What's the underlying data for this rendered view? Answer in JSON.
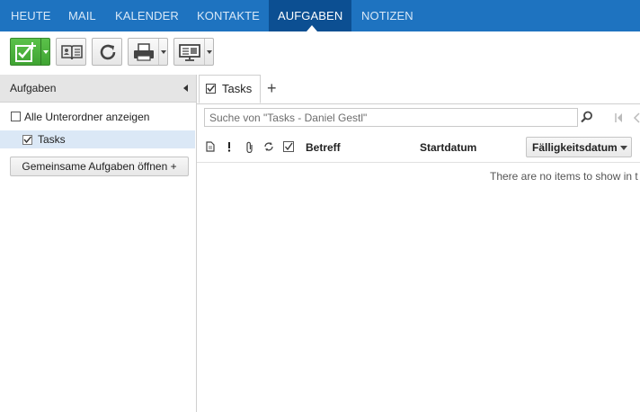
{
  "nav": {
    "items": [
      "HEUTE",
      "MAIL",
      "KALENDER",
      "KONTAKTE",
      "AUFGABEN",
      "NOTIZEN"
    ],
    "active_index": 4
  },
  "toolbar": {
    "buttons": [
      "new-task",
      "address-book",
      "refresh",
      "print",
      "view"
    ]
  },
  "sidebar": {
    "title": "Aufgaben",
    "show_subfolders_label": "Alle Unterordner anzeigen",
    "folders": [
      {
        "label": "Tasks",
        "checked": true
      }
    ],
    "shared_button_label": "Gemeinsame Aufgaben öffnen +"
  },
  "tabs": [
    {
      "label": "Tasks",
      "checked": true
    }
  ],
  "search": {
    "placeholder": "Suche von \"Tasks - Daniel Gestl\""
  },
  "columns": {
    "icons": [
      "document-icon",
      "importance-icon",
      "attachment-icon",
      "recurrence-icon",
      "checkbox-icon"
    ],
    "subject": "Betreff",
    "start": "Startdatum",
    "due": "Fälligkeitsdatum"
  },
  "empty_message": "There are no items to show in t",
  "colors": {
    "nav_bg": "#1e73c0",
    "nav_active": "#0c4f92",
    "selected_row": "#dbe8f6",
    "new_button": "#4cb43d"
  }
}
